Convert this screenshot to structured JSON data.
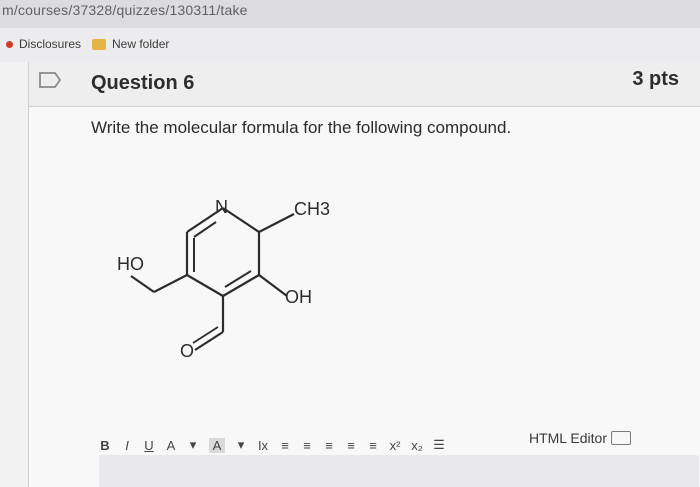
{
  "browser": {
    "url": "m/courses/37328/quizzes/130311/take",
    "bookmarks": [
      "Disclosures",
      "New folder"
    ]
  },
  "question": {
    "title": "Question 6",
    "points": "3 pts",
    "prompt": "Write the molecular formula for the following compound."
  },
  "molecule": {
    "n_label": "N",
    "ch3_label": "CH3",
    "ho_label": "HO",
    "oh_label": "OH",
    "o_label": "O"
  },
  "editor": {
    "toolbar": [
      "B",
      "I",
      "U",
      "A",
      "▾",
      "A",
      "▾",
      "Ix",
      "≡",
      "≡",
      "≡",
      "≡",
      "≡",
      "x²",
      "x₂",
      "☰"
    ],
    "html_editor_label": "HTML Editor"
  }
}
